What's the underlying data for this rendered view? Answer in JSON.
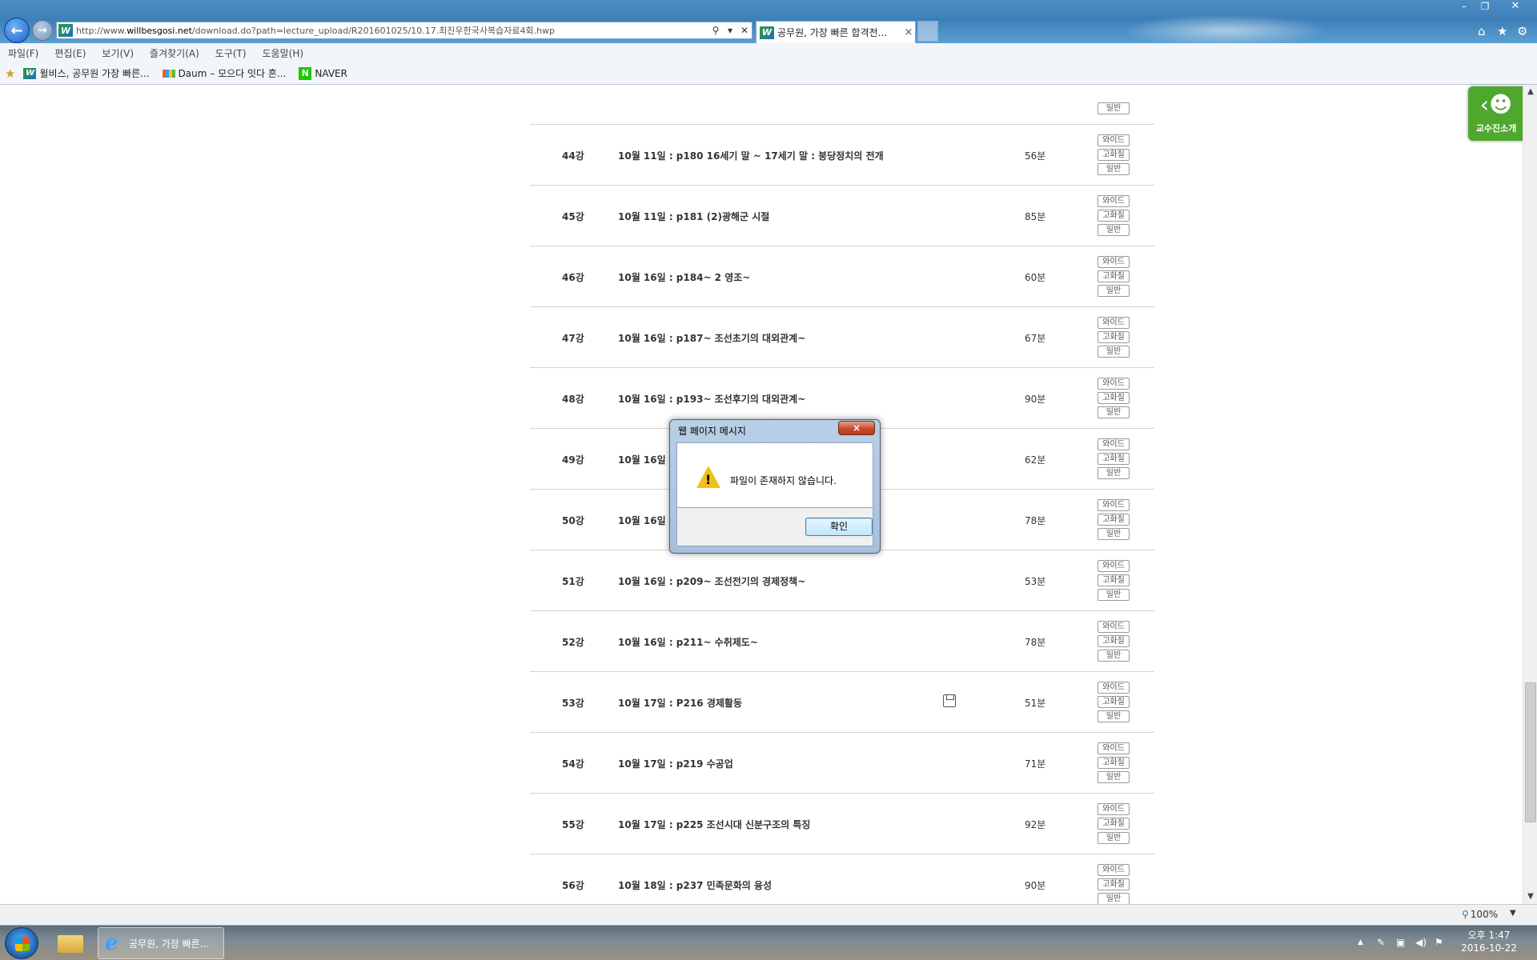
{
  "browser": {
    "url_prefix": "http://www.",
    "url_domain": "willbesgosi.net",
    "url_path": "/download.do?path=lecture_upload/R201601025/10.17.최진우한국사복습자료4회.hwp",
    "site_icon_letter": "W",
    "tab_title": "공무원, 가장 빠른 합격전...",
    "close_glyph": "×",
    "menu": [
      "파일(F)",
      "편집(E)",
      "보기(V)",
      "즐겨찾기(A)",
      "도구(T)",
      "도움말(H)"
    ],
    "favorites": [
      {
        "label": "윌비스, 공무원 가장 빠른...",
        "icon": "willbes-icon"
      },
      {
        "label": "Daum – 모으다 잇다 흔...",
        "icon": "daum-icon"
      },
      {
        "label": "NAVER",
        "icon": "naver-icon"
      }
    ],
    "naver_letter": "N",
    "zoom": "100%"
  },
  "lectures": [
    {
      "no": "44강",
      "title": "10월 11일 : p180 16세기 말 ~ 17세기 말 : 붕당정치의 전개",
      "duration": "56분",
      "has_download": false
    },
    {
      "no": "45강",
      "title": "10월 11일 : p181 (2)광해군 시절",
      "duration": "85분",
      "has_download": false
    },
    {
      "no": "46강",
      "title": "10월 16일 : p184~ 2 영조~",
      "duration": "60분",
      "has_download": false
    },
    {
      "no": "47강",
      "title": "10월 16일 : p187~ 조선초기의 대외관계~",
      "duration": "67분",
      "has_download": false
    },
    {
      "no": "48강",
      "title": "10월 16일 : p193~ 조선후기의 대외관계~",
      "duration": "90분",
      "has_download": false
    },
    {
      "no": "49강",
      "title": "10월 16일",
      "duration": "62분",
      "has_download": false
    },
    {
      "no": "50강",
      "title": "10월 16일",
      "duration": "78분",
      "has_download": false
    },
    {
      "no": "51강",
      "title": "10월 16일 : p209~ 조선전기의 경제정책~",
      "duration": "53분",
      "has_download": false
    },
    {
      "no": "52강",
      "title": "10월 16일 : p211~ 수취제도~",
      "duration": "78분",
      "has_download": false
    },
    {
      "no": "53강",
      "title": "10월 17일 : P216 경제활동",
      "duration": "51분",
      "has_download": true
    },
    {
      "no": "54강",
      "title": "10월 17일 : p219 수공업",
      "duration": "71분",
      "has_download": false
    },
    {
      "no": "55강",
      "title": "10월 17일 : p225 조선시대 신분구조의 특징",
      "duration": "92분",
      "has_download": false
    },
    {
      "no": "56강",
      "title": "10월 18일 : p237 민족문화의 융성",
      "duration": "90분",
      "has_download": false
    }
  ],
  "quality_options": [
    "와이드",
    "고화질",
    "일반"
  ],
  "professor_button": {
    "label": "교수진소개",
    "icon": "professor-icon"
  },
  "dialog": {
    "title": "웹 페이지 메시지",
    "message": "파일이 존재하지 않습니다.",
    "ok_label": "확인",
    "icon": "warning-icon"
  },
  "taskbar": {
    "ie_task_label": "공무원, 가장 빠른...",
    "clock_time": "오후 1:47",
    "clock_date": "2016-10-22"
  }
}
